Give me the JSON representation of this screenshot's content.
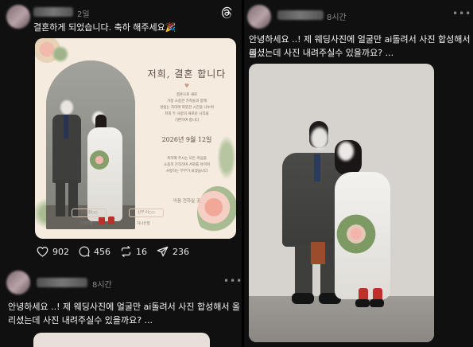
{
  "left": {
    "post1": {
      "time": "2일",
      "text": "결혼하게 되었습니다. 축하 해주세요🎉",
      "threads_icon": "threads-logo-icon",
      "invite": {
        "title": "저희, 결혼 합니다",
        "lines": [
          "결혼으로 새로",
          "가정 소중한 가족들과 함께",
          "성립는 자리에 따뜻한 시간을 나누며",
          "저희 두 사람의 새로운 시작을",
          "기쁜하여 합니다"
        ],
        "date": "2026년 9월 12일",
        "date_lines": [
          "축하해 주시는 모든 마음을",
          "소중히 간직하며 서로를 아끼며",
          "사랑하는 부부가 되겠습니다"
        ],
        "account_title": "마음 전하실 곳",
        "account_groom": "신랑 김○○",
        "account_bride": "신부 이○○",
        "bank_groom": "신한은행",
        "bank_bride": "하나은행"
      },
      "likes": "902",
      "comments": "456",
      "reposts": "16",
      "shares": "236"
    },
    "post2": {
      "time": "8시간",
      "text_line1": "안녕하세요 ..! 제 웨딩사진에 얼굴만 ai돌려서 사진 합성해서 올",
      "text_line2": "리셨는데 사진 내려주실수 있을까요? ...",
      "more_icon": "more-dots-icon"
    }
  },
  "right": {
    "post": {
      "time": "8시간",
      "text_line1": "안녕하세요 ..! 제 웨딩사진에 얼굴만 ai돌려서 사진 합성해서 올",
      "text_line2": "리셨는데 사진 내려주실수 있을까요? ...",
      "more_icon": "more-dots-icon"
    }
  },
  "colors": {
    "background": "#101010",
    "text": "#f3f5f7",
    "muted": "#8a8a8a",
    "card": "#f5ecdf"
  }
}
